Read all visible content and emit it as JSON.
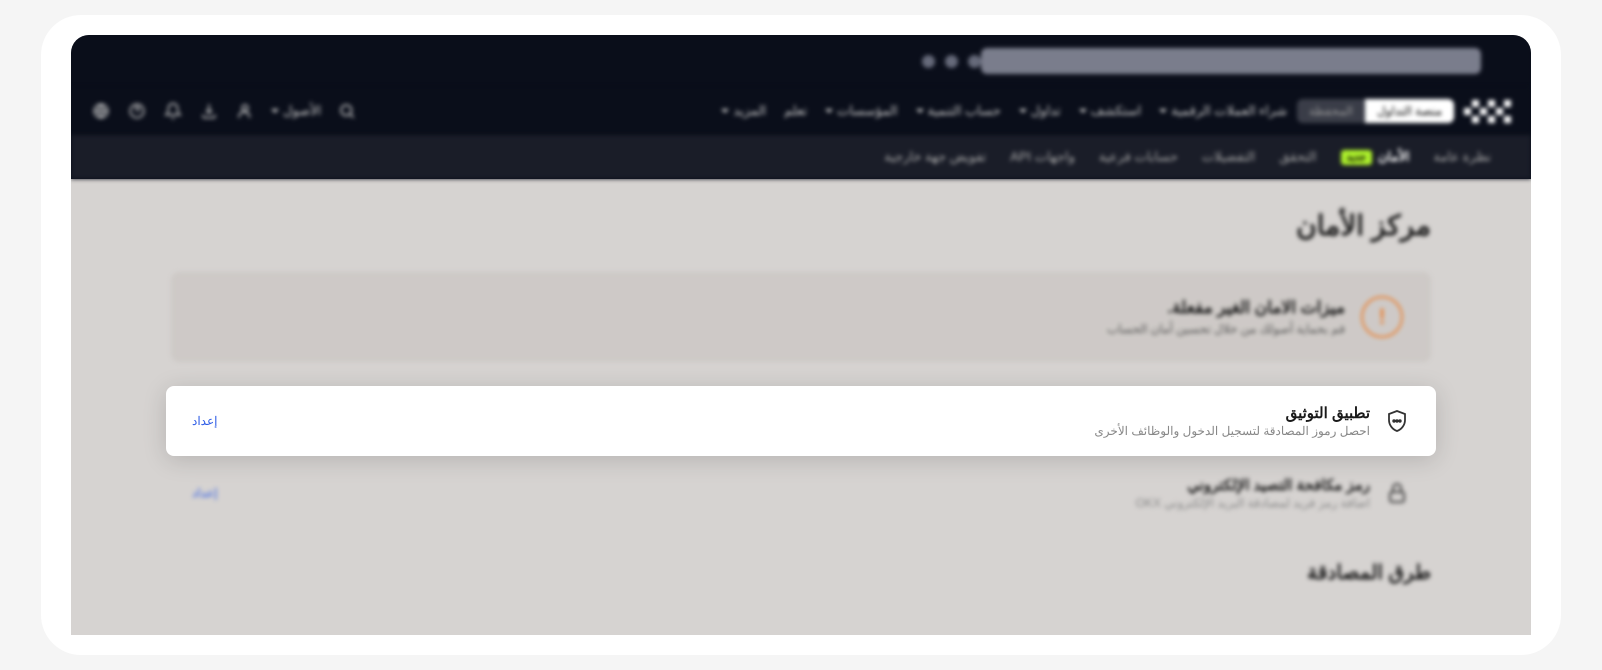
{
  "tabs": {
    "trading": "منصة التداول",
    "wallet": "المحفظة"
  },
  "topNav": {
    "items": [
      "شراء العملات الرقمية",
      "استكشف",
      "تداول",
      "حساب التنمية",
      "المؤسسات",
      "تعلم",
      "المزيد"
    ],
    "assets": "الأصول"
  },
  "secondaryNav": {
    "overview": "نظرة عامة",
    "security": "الأمان",
    "newBadge": "جديد",
    "verification": "التحقق",
    "preferences": "التفضيلات",
    "subAccounts": "حسابات فرعية",
    "api": "واجهات API",
    "external": "تفويض جهة خارجية"
  },
  "page": {
    "title": "مركز الأمان"
  },
  "alert": {
    "title": "ميزات الامان الغير مفعلة.",
    "desc": "قم بحماية أصولك من خلال تحسين أمان الحساب"
  },
  "cards": {
    "authenticator": {
      "title": "تطبيق التوثيق",
      "desc": "احصل رموز المصادقة لتسجيل الدخول والوظائف الأخرى",
      "action": "إعداد"
    },
    "antiphishing": {
      "title": "رمز مكافحة التصيد الإلكتروني",
      "desc": "اضافة رمز فريد لمصادقة البريد الإلكتروني OKX",
      "action": "إعداد"
    }
  },
  "section": {
    "authMethods": "طرق المصادقة"
  }
}
